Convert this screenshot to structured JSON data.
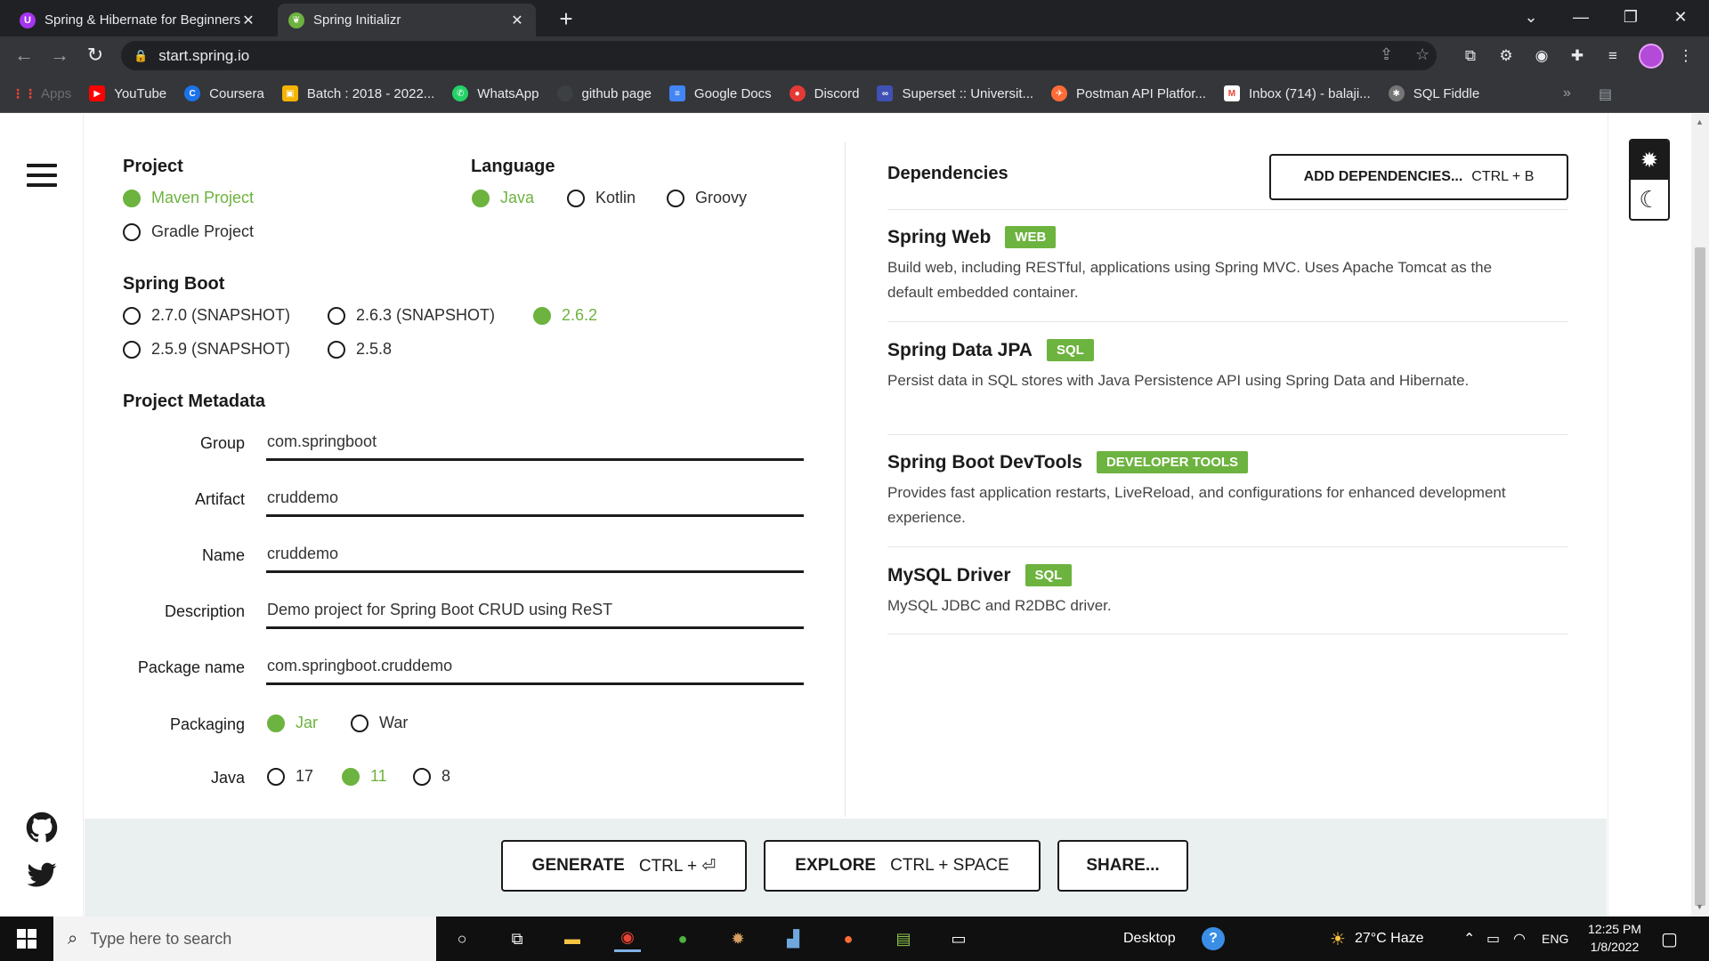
{
  "browser": {
    "tabs": [
      {
        "title": "Spring & Hibernate for Beginners",
        "favicon": "udemy-icon",
        "active": false
      },
      {
        "title": "Spring Initializr",
        "favicon": "spring-leaf-icon",
        "active": true
      }
    ],
    "url": "start.spring.io",
    "bookmarks": [
      {
        "label": "Apps",
        "icon": "apps-grid-icon",
        "color": "#ea4335"
      },
      {
        "label": "YouTube",
        "icon": "youtube-icon",
        "color": "#ff0000"
      },
      {
        "label": "Coursera",
        "icon": "coursera-icon",
        "color": "#1a73e8"
      },
      {
        "label": "Batch : 2018 - 2022...",
        "icon": "classroom-icon",
        "color": "#f4b400"
      },
      {
        "label": "WhatsApp",
        "icon": "whatsapp-icon",
        "color": "#25d366"
      },
      {
        "label": "github page",
        "icon": "globe-icon",
        "color": "#5f6368"
      },
      {
        "label": "Google Docs",
        "icon": "docs-icon",
        "color": "#4285f4"
      },
      {
        "label": "Discord",
        "icon": "discord-icon",
        "color": "#e53935"
      },
      {
        "label": "Superset :: Universit...",
        "icon": "superset-icon",
        "color": "#3f51b5"
      },
      {
        "label": "Postman API Platfor...",
        "icon": "postman-icon",
        "color": "#ff6c37"
      },
      {
        "label": "Inbox (714) - balaji...",
        "icon": "gmail-icon",
        "color": "#ea4335"
      },
      {
        "label": "SQL Fiddle",
        "icon": "sqlfiddle-icon",
        "color": "#9e9e9e"
      }
    ],
    "bookmarks_more": "»"
  },
  "project": {
    "title": "Project",
    "options": [
      {
        "label": "Maven Project",
        "checked": true
      },
      {
        "label": "Gradle Project",
        "checked": false
      }
    ]
  },
  "language": {
    "title": "Language",
    "options": [
      {
        "label": "Java",
        "checked": true
      },
      {
        "label": "Kotlin",
        "checked": false
      },
      {
        "label": "Groovy",
        "checked": false
      }
    ]
  },
  "spring_boot": {
    "title": "Spring Boot",
    "options": [
      {
        "label": "2.7.0 (SNAPSHOT)",
        "checked": false
      },
      {
        "label": "2.6.3 (SNAPSHOT)",
        "checked": false
      },
      {
        "label": "2.6.2",
        "checked": true
      },
      {
        "label": "2.5.9 (SNAPSHOT)",
        "checked": false
      },
      {
        "label": "2.5.8",
        "checked": false
      }
    ]
  },
  "metadata": {
    "title": "Project Metadata",
    "fields": [
      {
        "label": "Group",
        "value": "com.springboot"
      },
      {
        "label": "Artifact",
        "value": "cruddemo"
      },
      {
        "label": "Name",
        "value": "cruddemo"
      },
      {
        "label": "Description",
        "value": "Demo project for Spring Boot CRUD using ReST"
      },
      {
        "label": "Package name",
        "value": "com.springboot.cruddemo"
      }
    ],
    "packaging": {
      "label": "Packaging",
      "options": [
        {
          "label": "Jar",
          "checked": true
        },
        {
          "label": "War",
          "checked": false
        }
      ]
    },
    "java": {
      "label": "Java",
      "options": [
        {
          "label": "17",
          "checked": false
        },
        {
          "label": "11",
          "checked": true
        },
        {
          "label": "8",
          "checked": false
        }
      ]
    }
  },
  "dependencies": {
    "title": "Dependencies",
    "add_button": "ADD DEPENDENCIES...",
    "add_shortcut": "CTRL + B",
    "items": [
      {
        "name": "Spring Web",
        "badge": "WEB",
        "description": "Build web, including RESTful, applications using Spring MVC. Uses Apache Tomcat as the default embedded container."
      },
      {
        "name": "Spring Data JPA",
        "badge": "SQL",
        "description": "Persist data in SQL stores with Java Persistence API using Spring Data and Hibernate."
      },
      {
        "name": "Spring Boot DevTools",
        "badge": "DEVELOPER TOOLS",
        "description": "Provides fast application restarts, LiveReload, and configurations for enhanced development experience."
      },
      {
        "name": "MySQL Driver",
        "badge": "SQL",
        "description": "MySQL JDBC and R2DBC driver."
      }
    ]
  },
  "footer": {
    "generate": "GENERATE",
    "generate_shortcut": "CTRL + ⏎",
    "explore": "EXPLORE",
    "explore_shortcut": "CTRL + SPACE",
    "share": "SHARE..."
  },
  "taskbar": {
    "search_placeholder": "Type here to search",
    "desktop_label": "Desktop",
    "weather": "27°C  Haze",
    "language": "ENG",
    "time": "12:25 PM",
    "date": "1/8/2022"
  },
  "colors": {
    "accent": "#6db33f",
    "browser_dark": "#202124",
    "footer_bg": "#eaeff0"
  }
}
